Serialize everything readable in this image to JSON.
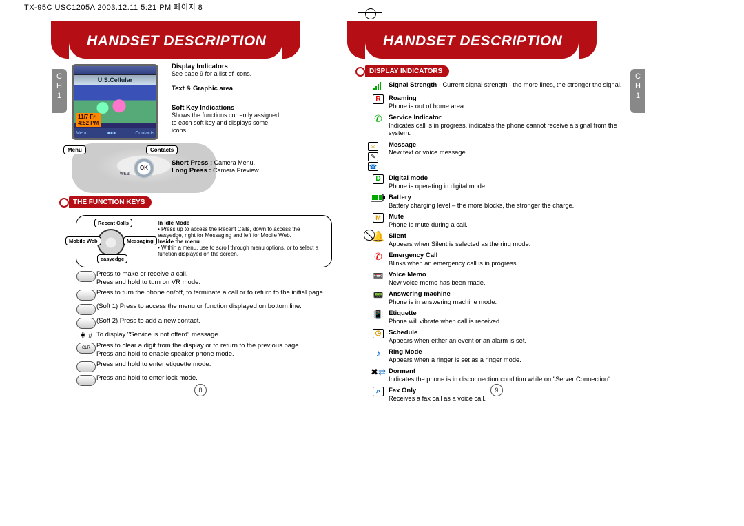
{
  "header_strip": "TX-95C USC1205A  2003.12.11  5:21 PM  페이지 8",
  "banner_title": "HANDSET DESCRIPTION",
  "ch_label": "C\nH\n1",
  "left": {
    "screen": {
      "carrier": "U.S.Cellular",
      "date_line1": "11/7 Fri",
      "date_line2": "4:52 PM",
      "soft_left": "Menu",
      "soft_right": "Contacts"
    },
    "callouts": {
      "disp_ind_t": "Display Indicators",
      "disp_ind_b": "See page 9 for a list of icons.",
      "text_area": "Text & Graphic area",
      "softkey_t": "Soft Key Indications",
      "softkey_b": "Shows the functions currently assigned to each soft key and displays some icons.",
      "short_t": "Short Press :",
      "short_v": "Camera Menu.",
      "long_t": "Long Press :",
      "long_v": "Camera Preview."
    },
    "pill_menu": "Menu",
    "pill_contacts": "Contacts",
    "section_fn": "THE FUNCTION KEYS",
    "fn_box": {
      "recent": "Recent Calls",
      "web": "Mobile Web",
      "msg": "Messaging",
      "easy": "easyedge",
      "idle_t": "In Idle Mode",
      "idle_b": "• Press up to access the Recent Calls, down to access the easyedge, right for Messaging and left for Mobile Web.",
      "inside_t": "Inside the menu",
      "inside_b": "• Within a menu, use to scroll through menu options, or to select a function displayed on the screen."
    },
    "keys": [
      "Press to make or receive a call.\nPress and hold to turn on VR mode.",
      "Press to turn the phone on/off, to terminate a call or to return to the initial page.",
      "(Soft 1) Press to access the menu or function displayed on bottom line.",
      "(Soft 2) Press to add a new contact.",
      "To display \"Service is not offerd\" message.",
      "Press to clear a digit from the display or to return to the previous page.\nPress and hold to enable speaker phone mode.",
      "Press and hold to enter etiquette mode.",
      "Press and hold to enter lock mode."
    ],
    "page_num": "8"
  },
  "right": {
    "section": "DISPLAY INDICATORS",
    "indicators": [
      {
        "t": "Signal Strength",
        "d": " - Current signal strength : the more lines, the stronger the signal."
      },
      {
        "t": "Roaming",
        "d": "Phone is out of home area."
      },
      {
        "t": "Service Indicator",
        "d": "  Indicates call is in progress,   indicates the phone cannot receive a signal from the system."
      },
      {
        "t": "Message",
        "d": "New text or voice message."
      },
      {
        "t": "Digital mode",
        "d": "Phone is operating in digital mode."
      },
      {
        "t": "Battery",
        "d": "Battery charging level – the more blocks, the stronger the charge."
      },
      {
        "t": "Mute",
        "d": "Phone is mute during a call."
      },
      {
        "t": "Silent",
        "d": "Appears when Silent is selected as the ring mode."
      },
      {
        "t": "Emergency Call",
        "d": "Blinks when an emergency call is in progress."
      },
      {
        "t": "Voice Memo",
        "d": "New voice memo has been made."
      },
      {
        "t": "Answering machine",
        "d": "Phone is in answering machine mode."
      },
      {
        "t": "Etiquette",
        "d": "Phone will vibrate when call is received."
      },
      {
        "t": "Schedule",
        "d": "Appears when either an event or an alarm is set."
      },
      {
        "t": "Ring Mode",
        "d": "Appears when a ringer is set as a ringer mode."
      },
      {
        "t": "Dormant",
        "d": "Indicates the phone is in disconnection condition while on \"Server Connection\"."
      },
      {
        "t": "Fax Only",
        "d": "Receives a fax call as a voice call."
      }
    ],
    "page_num": "9"
  }
}
